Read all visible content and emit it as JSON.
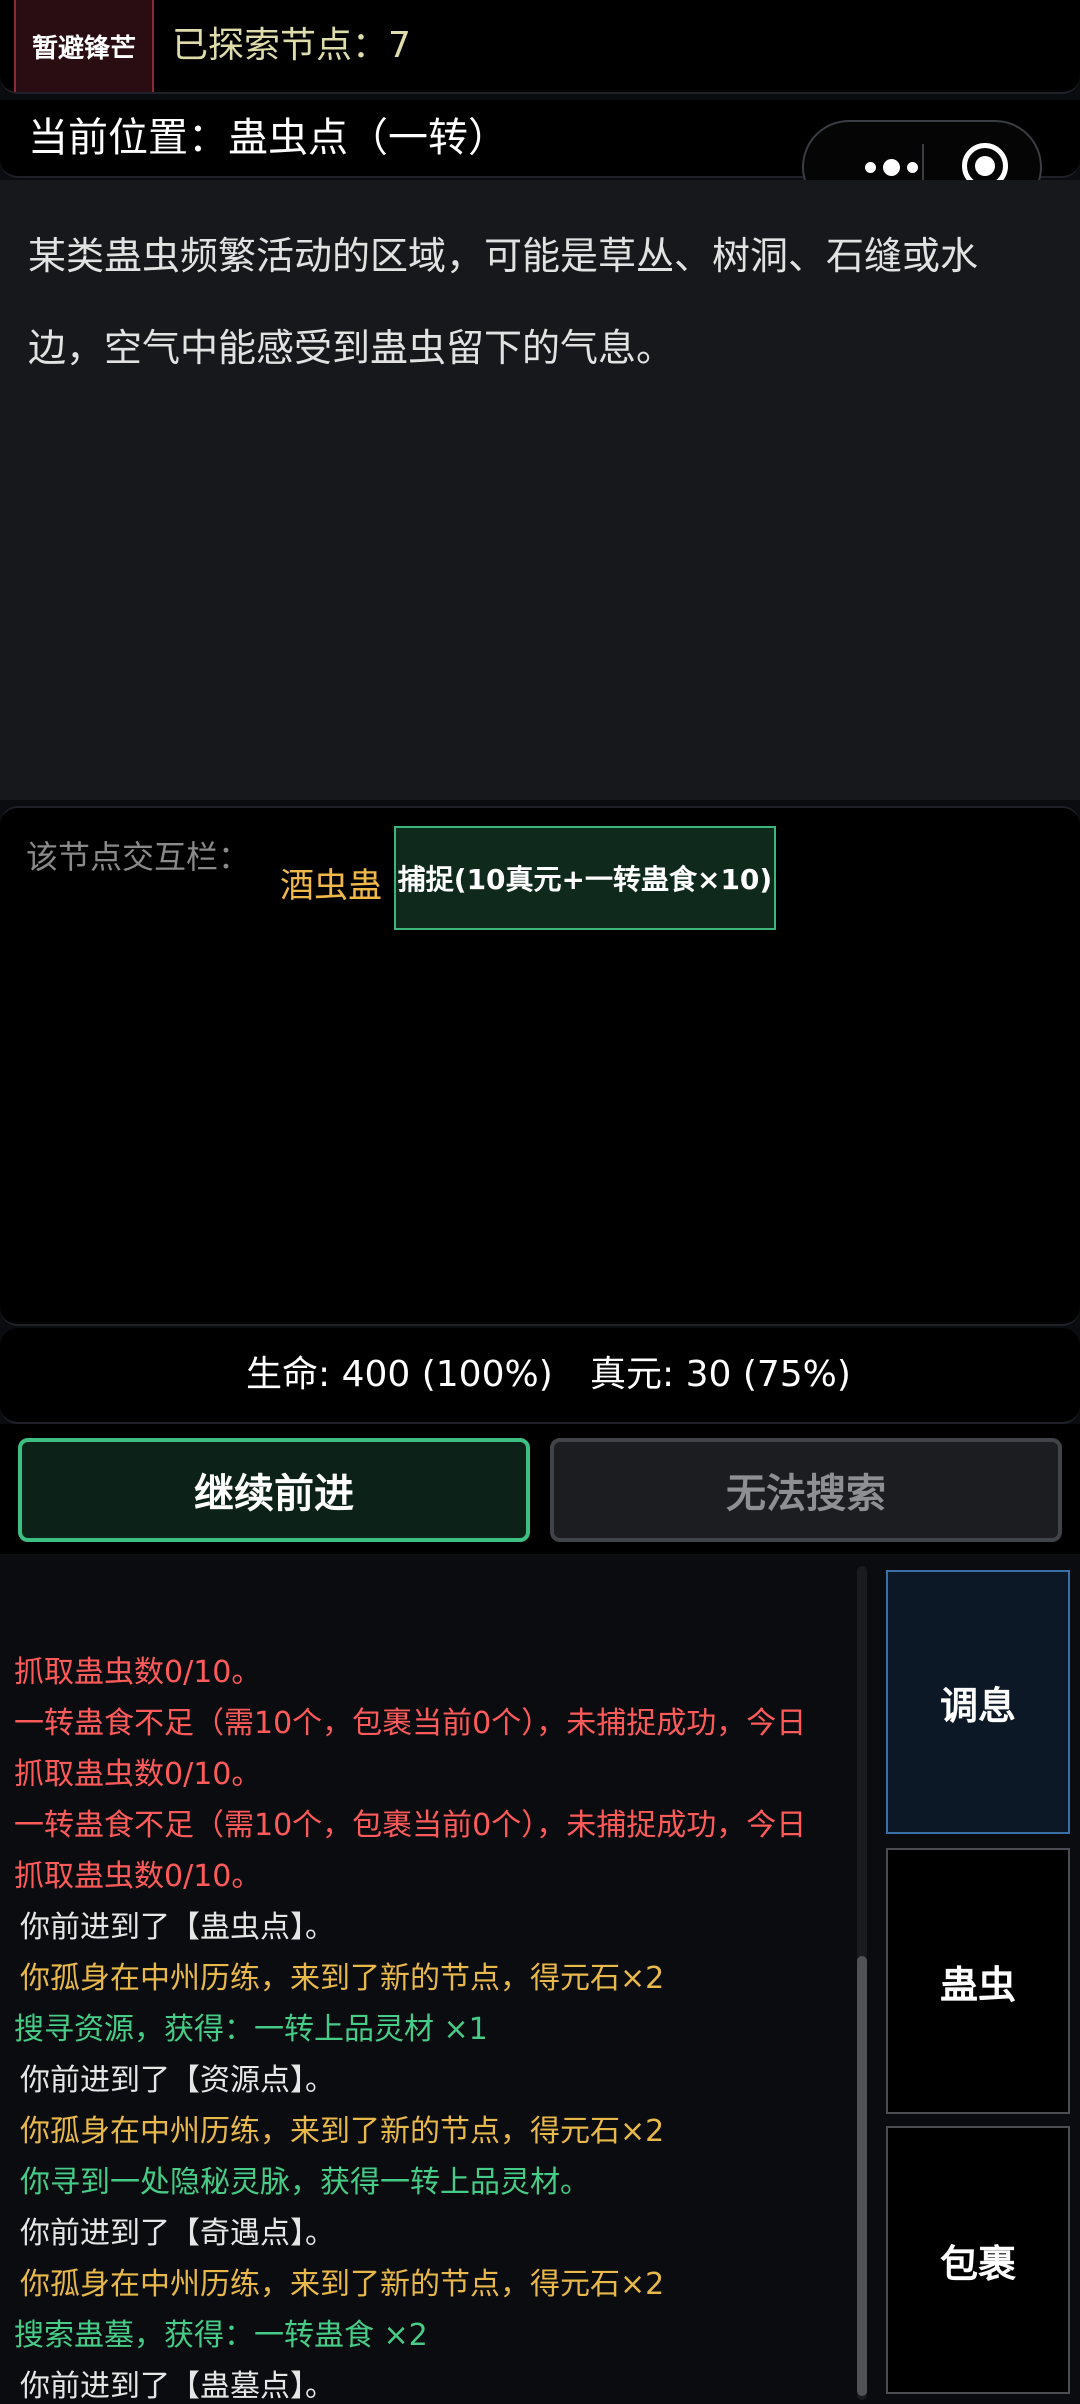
{
  "header": {
    "retreat_button": "暂避锋芒",
    "explored_nodes": "已探索节点：7",
    "location": "当前位置：蛊虫点（一转）"
  },
  "description": "某类蛊虫频繁活动的区域，可能是草丛、树洞、石缝或水边，空气中能感受到蛊虫留下的气息。",
  "interaction": {
    "label": "该节点交互栏：",
    "gu_name": "酒虫蛊",
    "catch_button": "捕捉(10真元+一转蛊食×10)"
  },
  "status": {
    "hp": "生命: 400 (100%)",
    "mp": "真元: 30 (75%)"
  },
  "actions": {
    "forward": "继续前进",
    "search": "无法搜索"
  },
  "side_menu": {
    "rest": "调息",
    "gu": "蛊虫",
    "bag": "包裹"
  },
  "colors": {
    "red": "#ff5a5a",
    "yellow": "#e9b84a",
    "green": "#46cc86",
    "white": "#e6e6e6"
  },
  "log": [
    {
      "text": "抓取蛊虫数0/10。",
      "color": "red",
      "indent": false
    },
    {
      "text": "一转蛊食不足（需10个，包裹当前0个），未捕捉成功，今日",
      "color": "red",
      "indent": false
    },
    {
      "text": "抓取蛊虫数0/10。",
      "color": "red",
      "indent": false
    },
    {
      "text": "一转蛊食不足（需10个，包裹当前0个），未捕捉成功，今日",
      "color": "red",
      "indent": false
    },
    {
      "text": "抓取蛊虫数0/10。",
      "color": "red",
      "indent": false
    },
    {
      "text": "你前进到了【蛊虫点】。",
      "color": "white",
      "indent": true
    },
    {
      "text": "你孤身在中州历练，来到了新的节点，得元石×2",
      "color": "yellow",
      "indent": true
    },
    {
      "text": "搜寻资源，获得：一转上品灵材 ×1",
      "color": "green",
      "indent": false
    },
    {
      "text": "你前进到了【资源点】。",
      "color": "white",
      "indent": true
    },
    {
      "text": "你孤身在中州历练，来到了新的节点，得元石×2",
      "color": "yellow",
      "indent": true
    },
    {
      "text": "你寻到一处隐秘灵脉，获得一转上品灵材。",
      "color": "green",
      "indent": true
    },
    {
      "text": "你前进到了【奇遇点】。",
      "color": "white",
      "indent": true
    },
    {
      "text": "你孤身在中州历练，来到了新的节点，得元石×2",
      "color": "yellow",
      "indent": true
    },
    {
      "text": "搜索蛊墓，获得：一转蛊食 ×2",
      "color": "green",
      "indent": false
    },
    {
      "text": "你前进到了【蛊墓点】。",
      "color": "white",
      "indent": true
    }
  ]
}
